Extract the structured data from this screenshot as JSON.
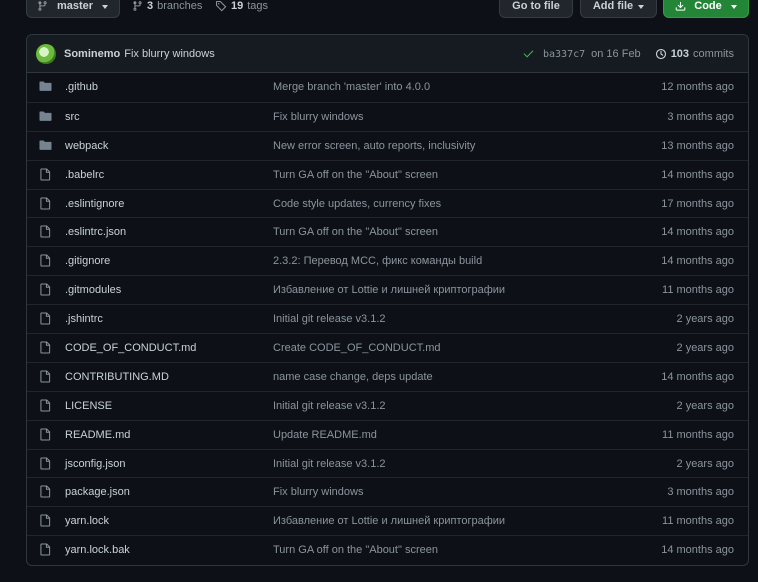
{
  "toolbar": {
    "branch_label": "master",
    "branches_count": "3",
    "branches_label": "branches",
    "tags_count": "19",
    "tags_label": "tags",
    "goto_file_label": "Go to file",
    "add_file_label": "Add file",
    "code_label": "Code"
  },
  "latest_commit": {
    "author": "Sominemo",
    "message": "Fix blurry windows",
    "sha": "ba337c7",
    "date": "on 16 Feb",
    "commits_count": "103",
    "commits_label": "commits"
  },
  "files": [
    {
      "type": "folder",
      "name": ".github",
      "message": "Merge branch 'master' into 4.0.0",
      "age": "12 months ago"
    },
    {
      "type": "folder",
      "name": "src",
      "message": "Fix blurry windows",
      "age": "3 months ago"
    },
    {
      "type": "folder",
      "name": "webpack",
      "message": "New error screen, auto reports, inclusivity",
      "age": "13 months ago"
    },
    {
      "type": "file",
      "name": ".babelrc",
      "message": "Turn GA off on the \"About\" screen",
      "age": "14 months ago"
    },
    {
      "type": "file",
      "name": ".eslintignore",
      "message": "Code style updates, currency fixes",
      "age": "17 months ago"
    },
    {
      "type": "file",
      "name": ".eslintrc.json",
      "message": "Turn GA off on the \"About\" screen",
      "age": "14 months ago"
    },
    {
      "type": "file",
      "name": ".gitignore",
      "message": "2.3.2: Перевод MCC, фикс команды build",
      "age": "14 months ago"
    },
    {
      "type": "file",
      "name": ".gitmodules",
      "message": "Избавление от Lottie и лишней криптографии",
      "age": "11 months ago"
    },
    {
      "type": "file",
      "name": ".jshintrc",
      "message": "Initial git release v3.1.2",
      "age": "2 years ago"
    },
    {
      "type": "file",
      "name": "CODE_OF_CONDUCT.md",
      "message": "Create CODE_OF_CONDUCT.md",
      "age": "2 years ago"
    },
    {
      "type": "file",
      "name": "CONTRIBUTING.MD",
      "message": "name case change, deps update",
      "age": "14 months ago"
    },
    {
      "type": "file",
      "name": "LICENSE",
      "message": "Initial git release v3.1.2",
      "age": "2 years ago"
    },
    {
      "type": "file",
      "name": "README.md",
      "message": "Update README.md",
      "age": "11 months ago"
    },
    {
      "type": "file",
      "name": "jsconfig.json",
      "message": "Initial git release v3.1.2",
      "age": "2 years ago"
    },
    {
      "type": "file",
      "name": "package.json",
      "message": "Fix blurry windows",
      "age": "3 months ago"
    },
    {
      "type": "file",
      "name": "yarn.lock",
      "message": "Избавление от Lottie и лишней криптографии",
      "age": "11 months ago"
    },
    {
      "type": "file",
      "name": "yarn.lock.bak",
      "message": "Turn GA off on the \"About\" screen",
      "age": "14 months ago"
    }
  ],
  "colors": {
    "background": "#0d1117",
    "border": "#30363d",
    "text": "#c9d1d9",
    "muted": "#8b949e",
    "green_button": "#238636",
    "check": "#3fb950",
    "folder_icon": "#768390"
  }
}
